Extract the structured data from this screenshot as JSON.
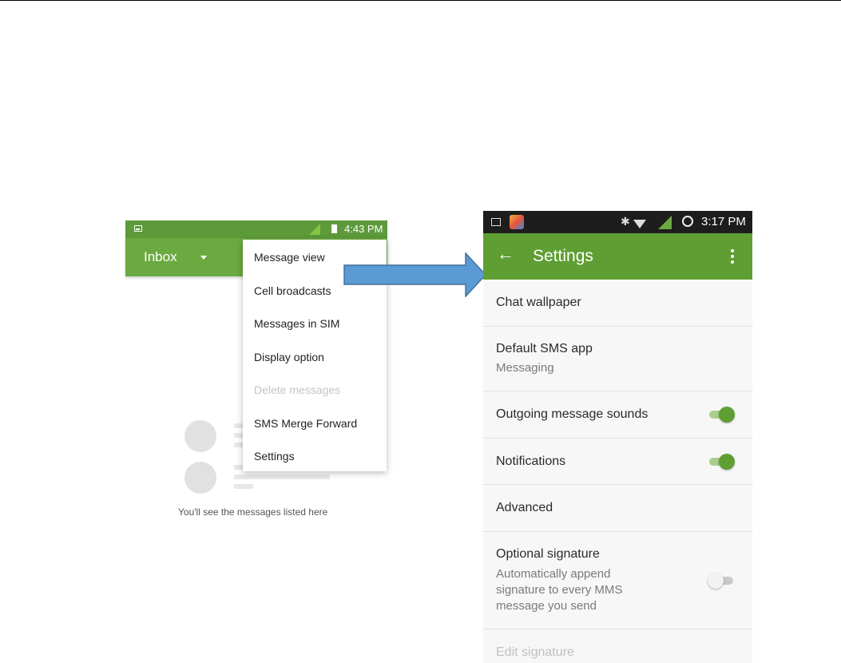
{
  "left_phone": {
    "status_time": "4:43 PM",
    "toolbar_title": "Inbox",
    "menu": [
      {
        "label": "Message view",
        "enabled": true
      },
      {
        "label": "Cell broadcasts",
        "enabled": true
      },
      {
        "label": "Messages in SIM",
        "enabled": true
      },
      {
        "label": "Display option",
        "enabled": true
      },
      {
        "label": "Delete messages",
        "enabled": false
      },
      {
        "label": "SMS Merge Forward",
        "enabled": true
      },
      {
        "label": "Settings",
        "enabled": true
      }
    ],
    "empty_text": "You'll see the messages listed here"
  },
  "arrow_color": "#5b9bd5",
  "right_phone": {
    "status_time": "3:17 PM",
    "toolbar_title": "Settings",
    "rows": [
      {
        "label": "Chat wallpaper"
      },
      {
        "label": "Default SMS app",
        "sub": "Messaging"
      },
      {
        "label": "Outgoing message sounds",
        "toggle": true
      },
      {
        "label": "Notifications",
        "toggle": true
      },
      {
        "label": "Advanced"
      },
      {
        "label": "Optional signature",
        "sub1": "Automatically append",
        "sub2": "signature to every MMS",
        "sub3": "message you send",
        "toggle": false
      },
      {
        "label": "Edit signature",
        "enabled": false
      }
    ]
  },
  "colors": {
    "accent_green": "#6aaa40",
    "toolbar_green_right": "#5f9e33",
    "status_green_left": "#5d9a3a"
  }
}
